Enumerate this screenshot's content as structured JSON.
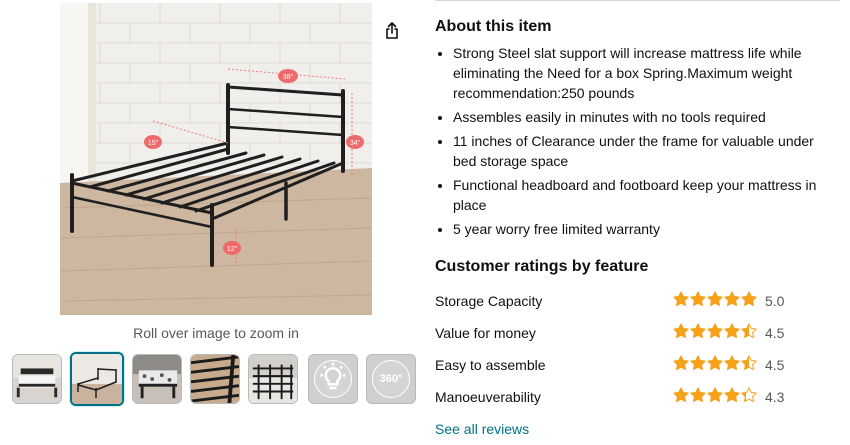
{
  "gallery": {
    "main_image_alt": "Black metal bed frame with headboard and dimension annotations",
    "dimension_labels": [
      "38\"",
      "15\"",
      "34\"",
      "12\""
    ],
    "zoom_hint": "Roll over image to zoom in",
    "thumbnails": [
      {
        "kind": "image"
      },
      {
        "kind": "image",
        "selected": true
      },
      {
        "kind": "image"
      },
      {
        "kind": "image"
      },
      {
        "kind": "image"
      },
      {
        "kind": "video",
        "icon": "lightbulb-icon"
      },
      {
        "kind": "video",
        "icon": "360-view-icon",
        "label": "360°"
      }
    ]
  },
  "share": {
    "icon": "share-icon"
  },
  "about": {
    "title": "About this item",
    "bullets": [
      "Strong Steel slat support will increase mattress life while eliminating the Need for a box Spring.Maximum weight recommendation:250 pounds",
      "Assembles easily in minutes with no tools required",
      "11 inches of Clearance under the frame for valuable under bed storage space",
      "Functional headboard and footboard keep your mattress in place",
      "5 year worry free limited warranty"
    ]
  },
  "ratings": {
    "title": "Customer ratings by feature",
    "features": [
      {
        "name": "Storage Capacity",
        "value": "5.0",
        "stars": 5.0
      },
      {
        "name": "Value for money",
        "value": "4.5",
        "stars": 4.5
      },
      {
        "name": "Easy to assemble",
        "value": "4.5",
        "stars": 4.5
      },
      {
        "name": "Manoeuverability",
        "value": "4.3",
        "stars": 4.3
      }
    ],
    "see_all": "See all reviews"
  },
  "colors": {
    "star": "#f5a11a",
    "link": "#007185",
    "selected_border": "#007185"
  }
}
